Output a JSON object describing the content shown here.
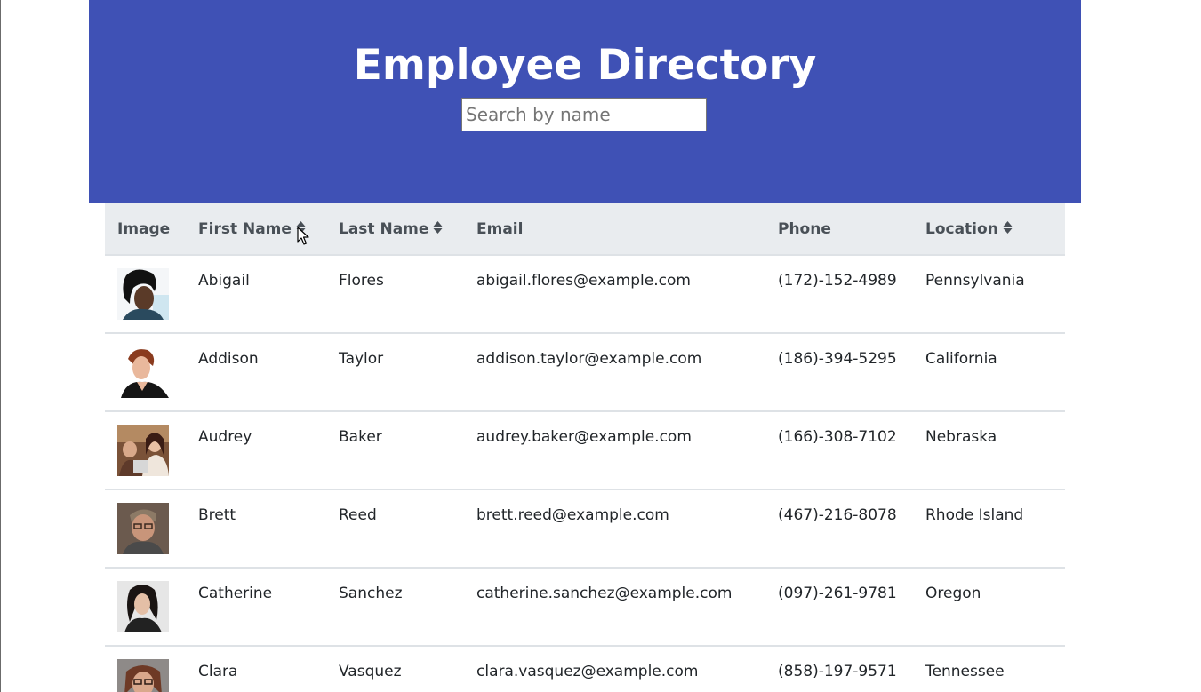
{
  "header": {
    "title": "Employee Directory",
    "search_placeholder": "Search by name",
    "background_color": "#3f51b5"
  },
  "table": {
    "columns": [
      {
        "label": "Image",
        "sortable": false
      },
      {
        "label": "First Name",
        "sortable": true
      },
      {
        "label": "Last Name",
        "sortable": true
      },
      {
        "label": "Email",
        "sortable": false
      },
      {
        "label": "Phone",
        "sortable": false
      },
      {
        "label": "Location",
        "sortable": true
      }
    ],
    "rows": [
      {
        "first": "Abigail",
        "last": "Flores",
        "email": "abigail.flores@example.com",
        "phone": "(172)-152-4989",
        "location": "Pennsylvania",
        "avatar": "avatar-photo"
      },
      {
        "first": "Addison",
        "last": "Taylor",
        "email": "addison.taylor@example.com",
        "phone": "(186)-394-5295",
        "location": "California",
        "avatar": "avatar-photo"
      },
      {
        "first": "Audrey",
        "last": "Baker",
        "email": "audrey.baker@example.com",
        "phone": "(166)-308-7102",
        "location": "Nebraska",
        "avatar": "avatar-photo"
      },
      {
        "first": "Brett",
        "last": "Reed",
        "email": "brett.reed@example.com",
        "phone": "(467)-216-8078",
        "location": "Rhode Island",
        "avatar": "avatar-photo"
      },
      {
        "first": "Catherine",
        "last": "Sanchez",
        "email": "catherine.sanchez@example.com",
        "phone": "(097)-261-9781",
        "location": "Oregon",
        "avatar": "avatar-photo"
      },
      {
        "first": "Clara",
        "last": "Vasquez",
        "email": "clara.vasquez@example.com",
        "phone": "(858)-197-9571",
        "location": "Tennessee",
        "avatar": "avatar-photo"
      }
    ]
  },
  "icons": {
    "sort": "sort-icon",
    "cursor": "mouse-cursor-icon"
  }
}
